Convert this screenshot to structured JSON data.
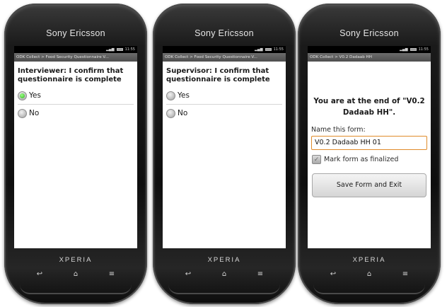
{
  "phones": [
    {
      "brand": "Sony Ericsson",
      "status_time": "11:55",
      "title": "ODK Collect > Food Security Questionnaire V...",
      "question": "Interviewer: I confirm that questionnaire is complete",
      "options": [
        {
          "label": "Yes",
          "selected": true
        },
        {
          "label": "No",
          "selected": false
        }
      ],
      "model": "XPERIA"
    },
    {
      "brand": "Sony Ericsson",
      "status_time": "11:55",
      "title": "ODK Collect > Food Security Questionnaire V...",
      "question": "Supervisor: I confirm that questionnaire is complete",
      "options": [
        {
          "label": "Yes",
          "selected": false
        },
        {
          "label": "No",
          "selected": false
        }
      ],
      "model": "XPERIA"
    },
    {
      "brand": "Sony Ericsson",
      "status_time": "11:55",
      "title": "ODK Collect > V0.2 Dadaab HH",
      "end_message": "You are at the end of \"V0.2 Dadaab HH\".",
      "name_label": "Name this form:",
      "name_value": "V0.2 Dadaab HH 01",
      "finalize_label": "Mark form as finalized",
      "finalize_checked": true,
      "save_button": "Save Form and Exit",
      "model": "XPERIA"
    }
  ],
  "colors": {
    "selected_radio": "#2fb31c",
    "input_border": "#e08b2a",
    "titlebar": "#5a5a5a"
  },
  "icons": {
    "back": "back-icon",
    "home": "home-icon",
    "menu": "menu-icon"
  }
}
